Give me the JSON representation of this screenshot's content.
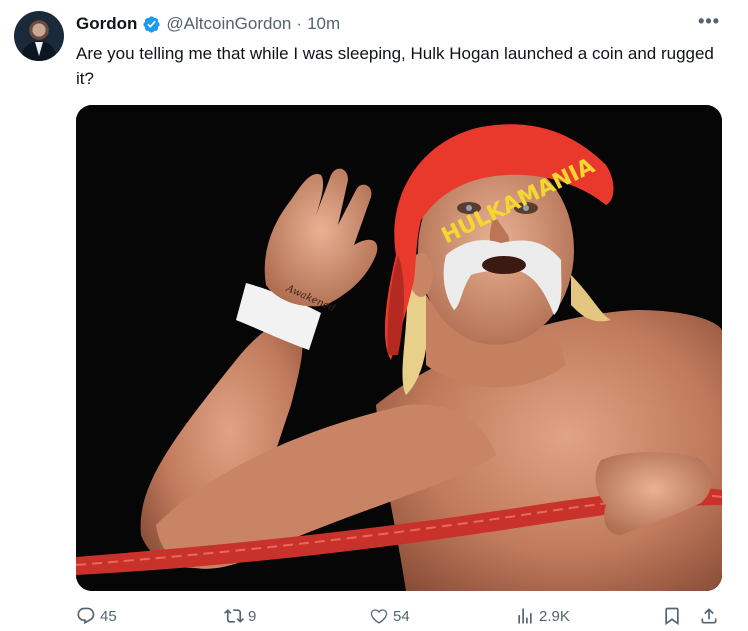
{
  "author": {
    "name": "Gordon",
    "handle": "@AltcoinGordon",
    "separator": "·",
    "timestamp": "10m",
    "verified": true,
    "verified_color": "#1d9bf0"
  },
  "tweet": {
    "text": "Are you telling me that while I was sleeping, Hulk Hogan launched a coin and rugged it?"
  },
  "media": {
    "bandana_text": "HULKAMANIA",
    "wrist_tattoo": "Awakened",
    "colors": {
      "bandana": "#e8392c",
      "bandana_text": "#f4d730",
      "background": "#060606",
      "ring_rope": "#c8322a"
    }
  },
  "actions": {
    "replies": "45",
    "reposts": "9",
    "likes": "54",
    "views": "2.9K"
  },
  "icons": {
    "more": "more-icon",
    "reply": "reply-icon",
    "repost": "repost-icon",
    "like": "heart-icon",
    "views": "views-icon",
    "bookmark": "bookmark-icon",
    "share": "share-icon"
  }
}
